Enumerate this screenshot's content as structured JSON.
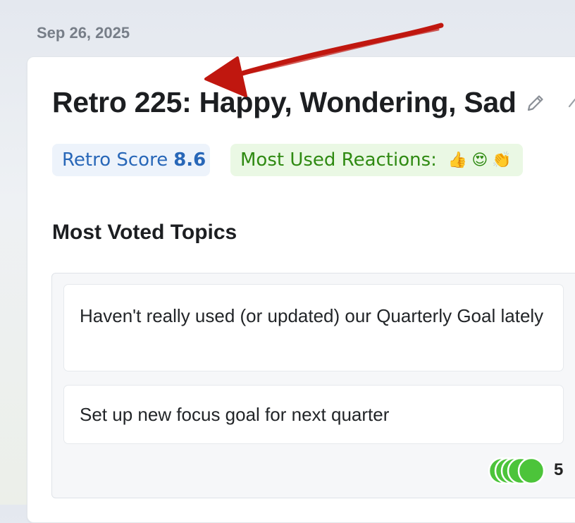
{
  "date": "Sep 26, 2025",
  "retro": {
    "title": "Retro 225: Happy, Wondering, Sad",
    "score_label": "Retro Score",
    "score_value": "8.6",
    "reactions_label": "Most Used Reactions:",
    "reactions": [
      "👍",
      "😍",
      "👏"
    ]
  },
  "topics": {
    "heading": "Most Voted Topics",
    "items": [
      {
        "text": "Haven't really used (or updated) our Quarterly Goal lately"
      },
      {
        "text": "Set up new focus goal for next quarter"
      }
    ],
    "vote_count": "5"
  },
  "colors": {
    "score": "#2867b8",
    "reactions": "#2f8a12",
    "vote_dots": "#4cc43a",
    "annotation_arrow": "#c0170f"
  },
  "icons": [
    "pencil-icon",
    "vote-dots-icon",
    "annotation-arrow"
  ]
}
